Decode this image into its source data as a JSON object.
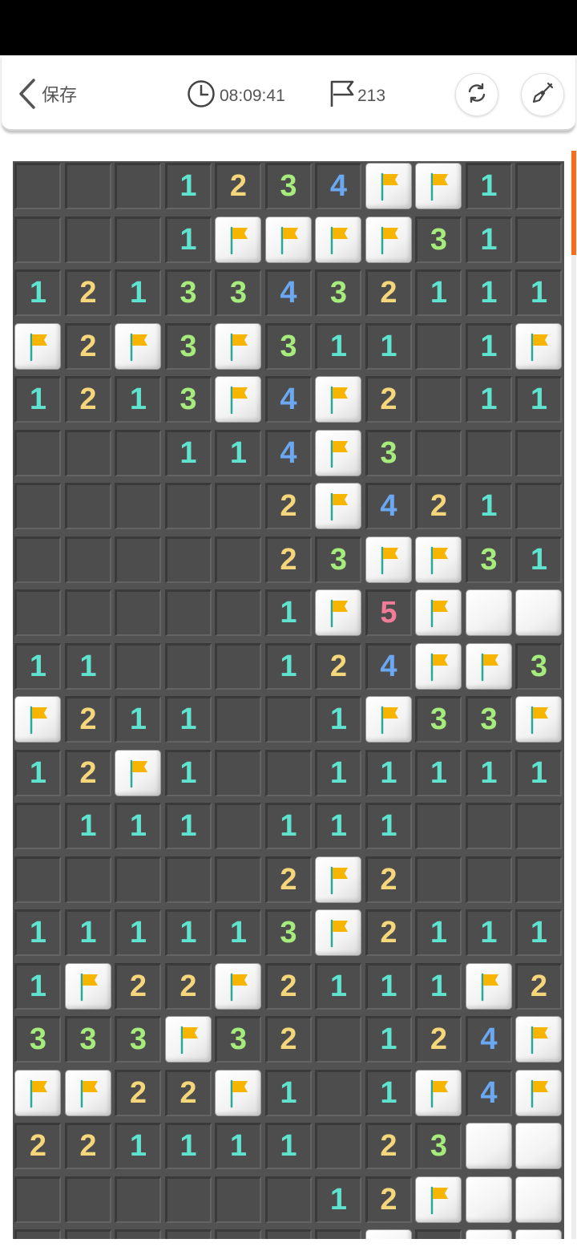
{
  "header": {
    "back_label": "保存",
    "timer": "08:09:41",
    "flags_remaining": "213",
    "icons": {
      "back": "chevron-left-icon",
      "timer": "clock-icon",
      "flags": "flag-outline-icon",
      "restart": "refresh-icon",
      "mode": "shovel-icon"
    }
  },
  "colors": {
    "1": "#5fe3cf",
    "2": "#f6d67a",
    "3": "#a6ec7c",
    "4": "#6aa8f2",
    "5": "#f27b9a",
    "scroll_thumb": "#ff6a1a",
    "flag": "#f7b500"
  },
  "board": {
    "columns": 11,
    "legend": "digits = revealed number, . = revealed empty, F = flag, # = unrevealed",
    "rows": [
      "...1234FF1.",
      "...1FFFF31.",
      "12133432111",
      "F2F3F311.1F",
      "1213F4F2.11",
      "...114F3...",
      ".....2F421.",
      ".....23FF31",
      ".....1F5F##",
      "11...124FF3",
      "F211..1F33F",
      "12F1..11111",
      ".111.111...",
      ".....2F2...",
      "111113F2111",
      "1F22F2111F2",
      "333F32.124F",
      "FF22F1.1F4F",
      "221111.23##",
      "......12F##",
      ".......F.FF"
    ]
  }
}
